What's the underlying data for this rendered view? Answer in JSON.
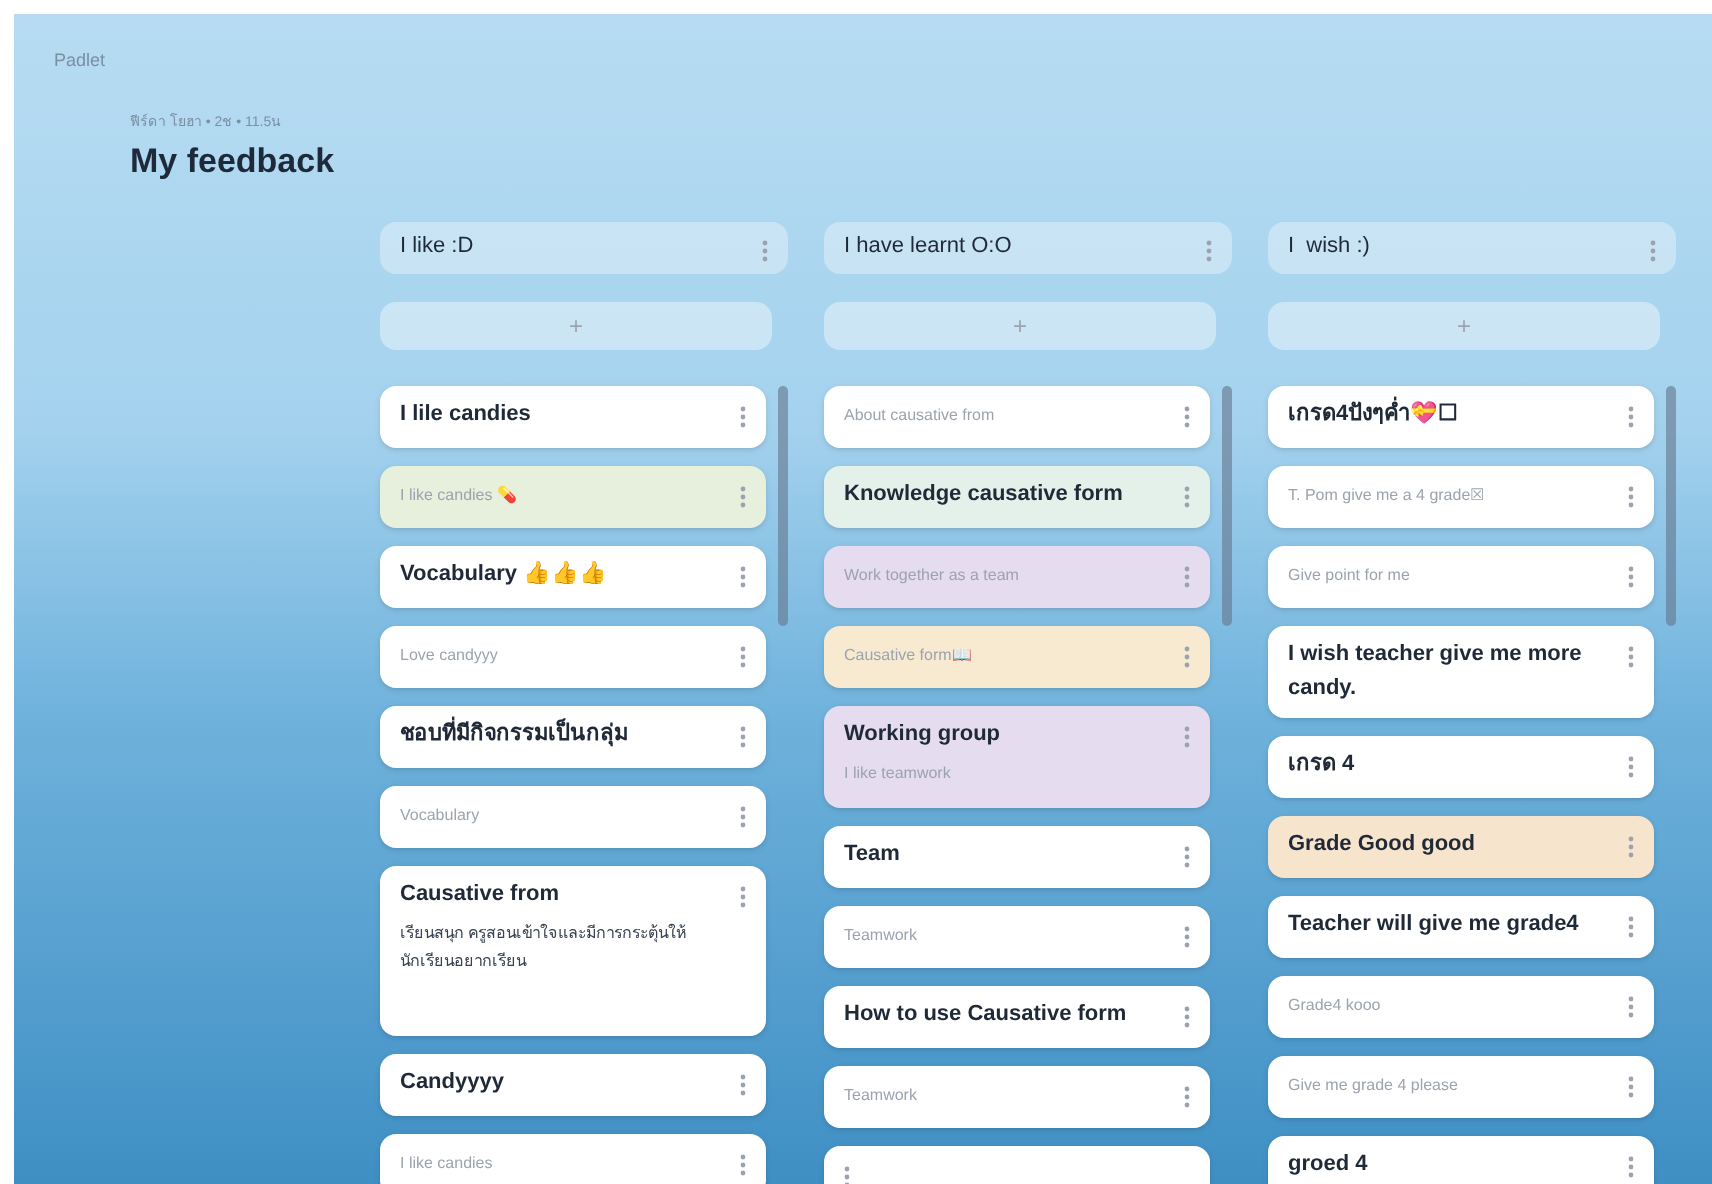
{
  "app_name": "Padlet",
  "board": {
    "meta": "ฟีร์ดา โยฮา • 2ช • 11.5น",
    "title": "My feedback"
  },
  "columns": [
    {
      "title": "I like :D",
      "add_label": "+",
      "posts": [
        {
          "kind": "title",
          "text": "I lile candies",
          "color": "#ffffff"
        },
        {
          "kind": "body",
          "text": "I like candies 💊",
          "color": "#e6f0dc"
        },
        {
          "kind": "title",
          "text": "Vocabulary 👍👍👍",
          "color": "#ffffff"
        },
        {
          "kind": "body",
          "text": "Love candyyy",
          "color": "#ffffff"
        },
        {
          "kind": "title",
          "text": "ชอบที่มีกิจกรรมเป็นกลุ่ม",
          "color": "#ffffff"
        },
        {
          "kind": "body",
          "text": "Vocabulary",
          "color": "#ffffff"
        },
        {
          "kind": "both",
          "text": "Causative from",
          "body": "เรียนสนุก ครูสอนเข้าใจและมีการกระตุ้นให้นักเรียนอยากเรียน",
          "color": "#ffffff"
        },
        {
          "kind": "title",
          "text": "Candyyyy",
          "color": "#ffffff"
        },
        {
          "kind": "body",
          "text": "I like candies",
          "color": "#ffffff"
        }
      ]
    },
    {
      "title": "I have learnt O:O",
      "add_label": "+",
      "posts": [
        {
          "kind": "body",
          "text": "About causative from",
          "color": "#ffffff"
        },
        {
          "kind": "title",
          "text": "Knowledge causative form",
          "color": "#e3f1ea"
        },
        {
          "kind": "body",
          "text": "Work together as a team",
          "color": "#e6dcf0"
        },
        {
          "kind": "body",
          "text": "Causative form📖",
          "color": "#f7ead0"
        },
        {
          "kind": "both",
          "text": "Working group",
          "body": "I like teamwork",
          "color": "#e6dcf0"
        },
        {
          "kind": "title",
          "text": "Team",
          "color": "#ffffff"
        },
        {
          "kind": "body",
          "text": "Teamwork",
          "color": "#ffffff"
        },
        {
          "kind": "title",
          "text": "How to use Causative form",
          "color": "#ffffff"
        },
        {
          "kind": "body",
          "text": "Teamwork",
          "color": "#ffffff"
        },
        {
          "kind": "empty",
          "color": "#ffffff"
        }
      ]
    },
    {
      "title": "I  wish :)",
      "add_label": "+",
      "posts": [
        {
          "kind": "title",
          "text": "เกรด4ปังๆค่ำ💝☐",
          "color": "#ffffff"
        },
        {
          "kind": "body",
          "text": "T. Pom give me a 4 grade☒",
          "color": "#ffffff"
        },
        {
          "kind": "body",
          "text": "Give point for me",
          "color": "#ffffff"
        },
        {
          "kind": "title",
          "text": "I wish teacher give me more candy.",
          "color": "#ffffff"
        },
        {
          "kind": "title",
          "text": "เกรด 4",
          "color": "#ffffff"
        },
        {
          "kind": "title",
          "text": "Grade Good good",
          "color": "#f6e4cc"
        },
        {
          "kind": "title",
          "text": "Teacher will give me grade4",
          "color": "#ffffff"
        },
        {
          "kind": "body",
          "text": "Grade4 kooo",
          "color": "#ffffff"
        },
        {
          "kind": "body",
          "text": "Give me grade 4 please",
          "color": "#ffffff"
        },
        {
          "kind": "title",
          "text": "groed 4",
          "color": "#ffffff"
        }
      ]
    }
  ]
}
